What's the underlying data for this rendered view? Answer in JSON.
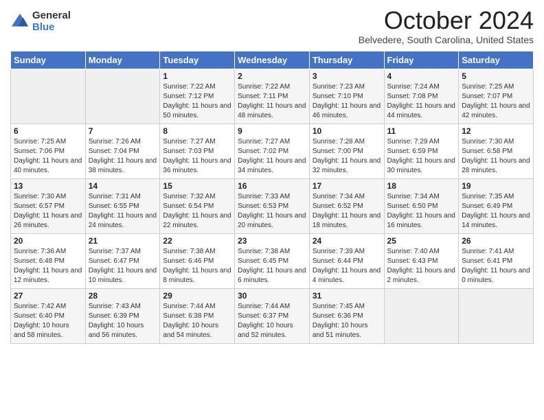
{
  "header": {
    "logo": {
      "general": "General",
      "blue": "Blue"
    },
    "title": "October 2024",
    "location": "Belvedere, South Carolina, United States"
  },
  "days_of_week": [
    "Sunday",
    "Monday",
    "Tuesday",
    "Wednesday",
    "Thursday",
    "Friday",
    "Saturday"
  ],
  "weeks": [
    [
      {
        "day": "",
        "sunrise": "",
        "sunset": "",
        "daylight": ""
      },
      {
        "day": "",
        "sunrise": "",
        "sunset": "",
        "daylight": ""
      },
      {
        "day": "1",
        "sunrise": "Sunrise: 7:22 AM",
        "sunset": "Sunset: 7:12 PM",
        "daylight": "Daylight: 11 hours and 50 minutes."
      },
      {
        "day": "2",
        "sunrise": "Sunrise: 7:22 AM",
        "sunset": "Sunset: 7:11 PM",
        "daylight": "Daylight: 11 hours and 48 minutes."
      },
      {
        "day": "3",
        "sunrise": "Sunrise: 7:23 AM",
        "sunset": "Sunset: 7:10 PM",
        "daylight": "Daylight: 11 hours and 46 minutes."
      },
      {
        "day": "4",
        "sunrise": "Sunrise: 7:24 AM",
        "sunset": "Sunset: 7:08 PM",
        "daylight": "Daylight: 11 hours and 44 minutes."
      },
      {
        "day": "5",
        "sunrise": "Sunrise: 7:25 AM",
        "sunset": "Sunset: 7:07 PM",
        "daylight": "Daylight: 11 hours and 42 minutes."
      }
    ],
    [
      {
        "day": "6",
        "sunrise": "Sunrise: 7:25 AM",
        "sunset": "Sunset: 7:06 PM",
        "daylight": "Daylight: 11 hours and 40 minutes."
      },
      {
        "day": "7",
        "sunrise": "Sunrise: 7:26 AM",
        "sunset": "Sunset: 7:04 PM",
        "daylight": "Daylight: 11 hours and 38 minutes."
      },
      {
        "day": "8",
        "sunrise": "Sunrise: 7:27 AM",
        "sunset": "Sunset: 7:03 PM",
        "daylight": "Daylight: 11 hours and 36 minutes."
      },
      {
        "day": "9",
        "sunrise": "Sunrise: 7:27 AM",
        "sunset": "Sunset: 7:02 PM",
        "daylight": "Daylight: 11 hours and 34 minutes."
      },
      {
        "day": "10",
        "sunrise": "Sunrise: 7:28 AM",
        "sunset": "Sunset: 7:00 PM",
        "daylight": "Daylight: 11 hours and 32 minutes."
      },
      {
        "day": "11",
        "sunrise": "Sunrise: 7:29 AM",
        "sunset": "Sunset: 6:59 PM",
        "daylight": "Daylight: 11 hours and 30 minutes."
      },
      {
        "day": "12",
        "sunrise": "Sunrise: 7:30 AM",
        "sunset": "Sunset: 6:58 PM",
        "daylight": "Daylight: 11 hours and 28 minutes."
      }
    ],
    [
      {
        "day": "13",
        "sunrise": "Sunrise: 7:30 AM",
        "sunset": "Sunset: 6:57 PM",
        "daylight": "Daylight: 11 hours and 26 minutes."
      },
      {
        "day": "14",
        "sunrise": "Sunrise: 7:31 AM",
        "sunset": "Sunset: 6:55 PM",
        "daylight": "Daylight: 11 hours and 24 minutes."
      },
      {
        "day": "15",
        "sunrise": "Sunrise: 7:32 AM",
        "sunset": "Sunset: 6:54 PM",
        "daylight": "Daylight: 11 hours and 22 minutes."
      },
      {
        "day": "16",
        "sunrise": "Sunrise: 7:33 AM",
        "sunset": "Sunset: 6:53 PM",
        "daylight": "Daylight: 11 hours and 20 minutes."
      },
      {
        "day": "17",
        "sunrise": "Sunrise: 7:34 AM",
        "sunset": "Sunset: 6:52 PM",
        "daylight": "Daylight: 11 hours and 18 minutes."
      },
      {
        "day": "18",
        "sunrise": "Sunrise: 7:34 AM",
        "sunset": "Sunset: 6:50 PM",
        "daylight": "Daylight: 11 hours and 16 minutes."
      },
      {
        "day": "19",
        "sunrise": "Sunrise: 7:35 AM",
        "sunset": "Sunset: 6:49 PM",
        "daylight": "Daylight: 11 hours and 14 minutes."
      }
    ],
    [
      {
        "day": "20",
        "sunrise": "Sunrise: 7:36 AM",
        "sunset": "Sunset: 6:48 PM",
        "daylight": "Daylight: 11 hours and 12 minutes."
      },
      {
        "day": "21",
        "sunrise": "Sunrise: 7:37 AM",
        "sunset": "Sunset: 6:47 PM",
        "daylight": "Daylight: 11 hours and 10 minutes."
      },
      {
        "day": "22",
        "sunrise": "Sunrise: 7:38 AM",
        "sunset": "Sunset: 6:46 PM",
        "daylight": "Daylight: 11 hours and 8 minutes."
      },
      {
        "day": "23",
        "sunrise": "Sunrise: 7:38 AM",
        "sunset": "Sunset: 6:45 PM",
        "daylight": "Daylight: 11 hours and 6 minutes."
      },
      {
        "day": "24",
        "sunrise": "Sunrise: 7:39 AM",
        "sunset": "Sunset: 6:44 PM",
        "daylight": "Daylight: 11 hours and 4 minutes."
      },
      {
        "day": "25",
        "sunrise": "Sunrise: 7:40 AM",
        "sunset": "Sunset: 6:43 PM",
        "daylight": "Daylight: 11 hours and 2 minutes."
      },
      {
        "day": "26",
        "sunrise": "Sunrise: 7:41 AM",
        "sunset": "Sunset: 6:41 PM",
        "daylight": "Daylight: 11 hours and 0 minutes."
      }
    ],
    [
      {
        "day": "27",
        "sunrise": "Sunrise: 7:42 AM",
        "sunset": "Sunset: 6:40 PM",
        "daylight": "Daylight: 10 hours and 58 minutes."
      },
      {
        "day": "28",
        "sunrise": "Sunrise: 7:43 AM",
        "sunset": "Sunset: 6:39 PM",
        "daylight": "Daylight: 10 hours and 56 minutes."
      },
      {
        "day": "29",
        "sunrise": "Sunrise: 7:44 AM",
        "sunset": "Sunset: 6:38 PM",
        "daylight": "Daylight: 10 hours and 54 minutes."
      },
      {
        "day": "30",
        "sunrise": "Sunrise: 7:44 AM",
        "sunset": "Sunset: 6:37 PM",
        "daylight": "Daylight: 10 hours and 52 minutes."
      },
      {
        "day": "31",
        "sunrise": "Sunrise: 7:45 AM",
        "sunset": "Sunset: 6:36 PM",
        "daylight": "Daylight: 10 hours and 51 minutes."
      },
      {
        "day": "",
        "sunrise": "",
        "sunset": "",
        "daylight": ""
      },
      {
        "day": "",
        "sunrise": "",
        "sunset": "",
        "daylight": ""
      }
    ]
  ]
}
